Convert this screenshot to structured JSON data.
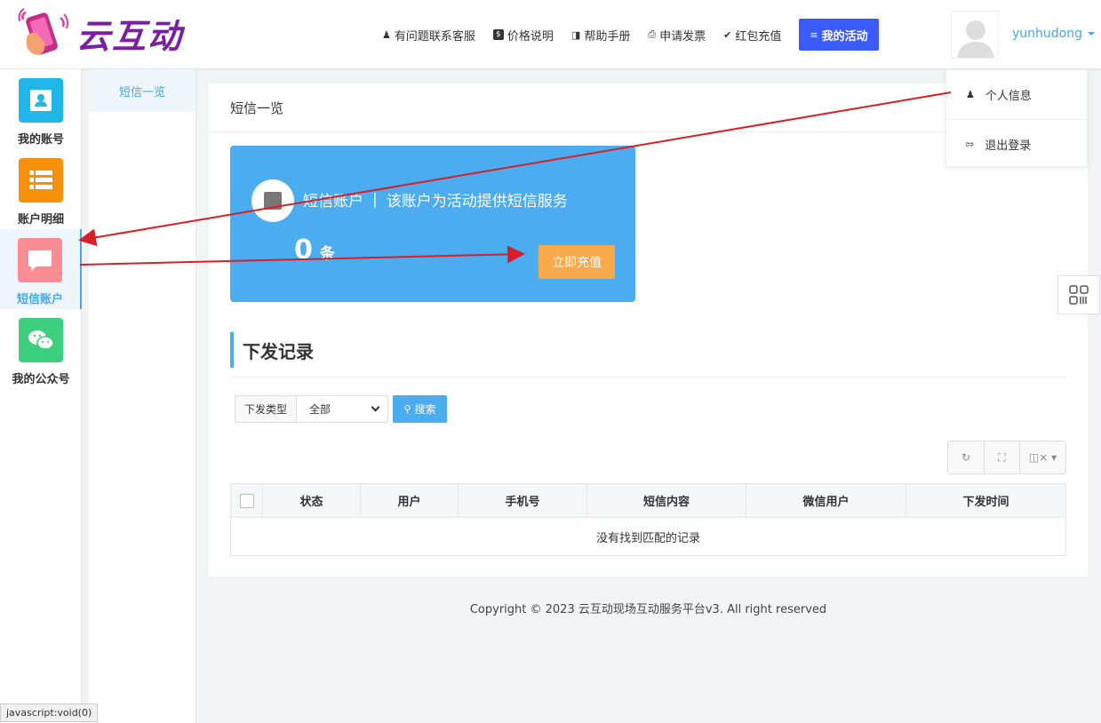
{
  "logo": {
    "text": "云互动"
  },
  "nav": {
    "items": [
      {
        "label": "有问题联系客服",
        "icon": "user-plus-icon"
      },
      {
        "label": "价格说明",
        "icon": "dollar-icon"
      },
      {
        "label": "帮助手册",
        "icon": "book-icon"
      },
      {
        "label": "申请发票",
        "icon": "printer-icon"
      },
      {
        "label": "红包充值",
        "icon": "shield-check-icon"
      }
    ],
    "my_activity": "我的活动",
    "username": "yunhudong"
  },
  "user_menu": {
    "items": [
      {
        "label": "个人信息",
        "icon": "user-icon"
      },
      {
        "label": "退出登录",
        "icon": "logout-icon"
      }
    ]
  },
  "sidebar": {
    "items": [
      {
        "label": "我的账号",
        "color": "#1fb6e8",
        "icon": "contact-card-icon"
      },
      {
        "label": "账户明细",
        "color": "#f7900a",
        "icon": "list-icon"
      },
      {
        "label": "短信账户",
        "color": "#f88d96",
        "icon": "chat-bubble-icon",
        "active": true
      },
      {
        "label": "我的公众号",
        "color": "#3ccf7e",
        "icon": "wechat-icon"
      }
    ]
  },
  "subnav": {
    "items": [
      {
        "label": "短信一览"
      }
    ]
  },
  "main": {
    "title": "短信一览",
    "sms_card": {
      "title": "短信账户",
      "separator": "|",
      "desc": "该账户为活动提供短信服务",
      "count": "0",
      "unit": "条",
      "recharge": "立即充值"
    },
    "records": {
      "title": "下发记录",
      "filter_label": "下发类型",
      "filter_value": "全部",
      "search": "搜索",
      "columns": [
        "状态",
        "用户",
        "手机号",
        "短信内容",
        "微信用户",
        "下发时间"
      ],
      "empty": "没有找到匹配的记录"
    }
  },
  "footer": "Copyright © 2023 云互动现场互动服务平台v3. All right reserved",
  "statusbar": "javascript:void(0)",
  "colors": {
    "accent": "#4bacf0",
    "nav_button": "#3b5bfd",
    "recharge": "#f8a949",
    "annotation_arrow": "#d81e27"
  }
}
